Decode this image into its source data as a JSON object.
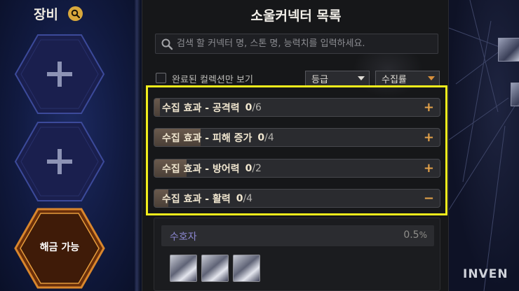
{
  "equipment": {
    "title": "장비",
    "slots": [
      {
        "state": "empty",
        "icon": "plus-icon"
      },
      {
        "state": "empty",
        "icon": "plus-icon"
      },
      {
        "state": "unlockable",
        "label": "해금 가능"
      }
    ]
  },
  "collector_panel": {
    "title": "소울커넥터 목록",
    "search": {
      "placeholder": "검색 할 커넥터 명, 스톤 명, 능력치를 입력하세요.",
      "value": ""
    },
    "filter": {
      "completed_only_label": "완료된 컬렉션만 보기",
      "completed_only_checked": false,
      "grade_dropdown": "등급",
      "sort_dropdown": "수집률"
    },
    "effects": [
      {
        "label": "수집 효과 - 공격력",
        "current": "0",
        "total": "/6",
        "toggle": "+",
        "progress": 0.0
      },
      {
        "label": "수집 효과 - 피해 증가",
        "current": "0",
        "total": "/4",
        "toggle": "+",
        "progress": 0.0
      },
      {
        "label": "수집 효과 - 방어력",
        "current": "0",
        "total": "/2",
        "toggle": "+",
        "progress": 0.0
      },
      {
        "label": "수집 효과 - 활력",
        "current": "0",
        "total": "/4",
        "toggle": "−",
        "progress": 0.0
      }
    ],
    "card": {
      "name": "수호자",
      "rate_value": "0.5",
      "rate_unit": "%",
      "thumb_count_label": ""
    }
  },
  "watermark": "INVEN",
  "colors": {
    "accent_orange": "#e3a24a",
    "highlight_yellow": "#f2ee1c",
    "hex_orange": "#d9862c",
    "hex_blue": "#3c4a9a",
    "card_name": "#8b86cf"
  }
}
